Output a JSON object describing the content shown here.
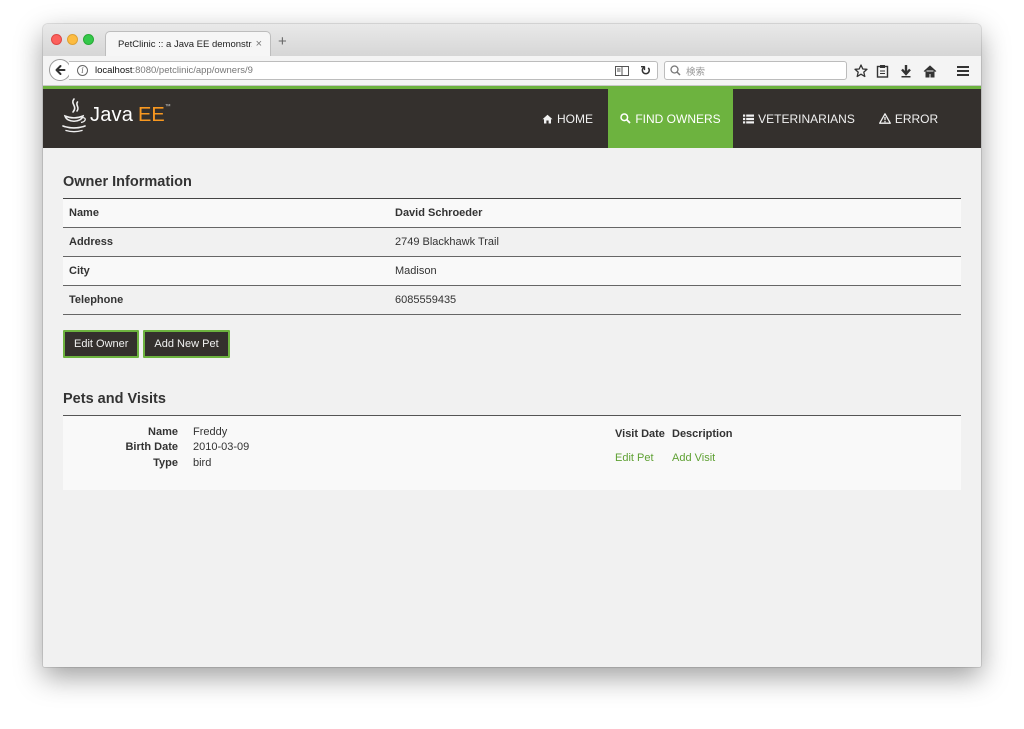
{
  "browser": {
    "tab_title": "PetClinic :: a Java EE demonstr...",
    "tab_close": "×",
    "new_tab": "+",
    "url_host": "localhost",
    "url_rest": ":8080/petclinic/app/owners/9",
    "search_placeholder": "検索"
  },
  "site": {
    "logo_text": "Java",
    "logo_suffix": "EE",
    "logo_tm": "™",
    "accent_color": "#6db33f",
    "header_color": "#34302d",
    "nav": [
      {
        "label": "Home",
        "icon": "home-icon",
        "active": false
      },
      {
        "label": "Find owners",
        "icon": "search-icon",
        "active": true
      },
      {
        "label": "Veterinarians",
        "icon": "list-icon",
        "active": false
      },
      {
        "label": "Error",
        "icon": "warning-icon",
        "active": false
      }
    ]
  },
  "owner": {
    "heading": "Owner Information",
    "rows": [
      {
        "label": "Name",
        "value": "David Schroeder"
      },
      {
        "label": "Address",
        "value": "2749 Blackhawk Trail"
      },
      {
        "label": "City",
        "value": "Madison"
      },
      {
        "label": "Telephone",
        "value": "6085559435"
      }
    ],
    "edit_button": "Edit Owner",
    "add_pet_button": "Add New Pet"
  },
  "pets": {
    "heading": "Pets and Visits",
    "items": [
      {
        "name_label": "Name",
        "name": "Freddy",
        "birth_label": "Birth Date",
        "birth_date": "2010-03-09",
        "type_label": "Type",
        "type": "bird",
        "visit_date_header": "Visit Date",
        "description_header": "Description",
        "edit_pet_link": "Edit Pet",
        "add_visit_link": "Add Visit"
      }
    ]
  }
}
